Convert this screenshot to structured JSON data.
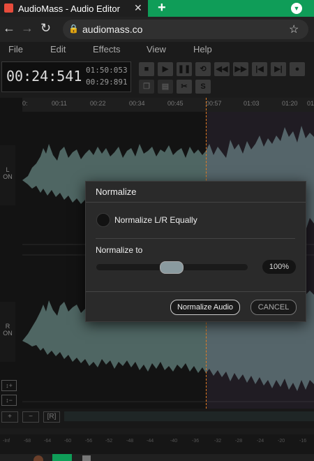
{
  "browser": {
    "tab_title": "AudioMass - Audio Editor",
    "new_tab": "+",
    "url": "audiomass.co"
  },
  "menu": [
    "File",
    "Edit",
    "Effects",
    "View",
    "Help"
  ],
  "timer": {
    "current": "00:24:541",
    "total": "01:50:053",
    "selection": "00:29:891"
  },
  "timeline_ticks": [
    "0:",
    "00:11",
    "00:22",
    "00:34",
    "00:45",
    "00:57",
    "01:03",
    "01:20",
    "01:"
  ],
  "channels": {
    "left": {
      "name": "L",
      "state": "ON"
    },
    "right": {
      "name": "R",
      "state": "ON"
    }
  },
  "meter_ticks": [
    "-Inf",
    "-68",
    "-64",
    "-60",
    "-56",
    "-52",
    "-48",
    "-44",
    "-40",
    "-36",
    "-32",
    "-28",
    "-24",
    "-20",
    "-16"
  ],
  "dialog": {
    "title": "Normalize",
    "toggle_label": "Normalize L/R Equally",
    "slider_label": "Normalize to",
    "slider_value": "100%",
    "slider_position": 0.5,
    "confirm_label": "Normalize Audio",
    "cancel_label": "CANCEL"
  },
  "bottom": {
    "add": "+",
    "remove": "−",
    "region": "[R]"
  },
  "colors": {
    "waveform": "#4f6663",
    "playhead": "#e67e22",
    "accent_green": "#0f9d58"
  }
}
